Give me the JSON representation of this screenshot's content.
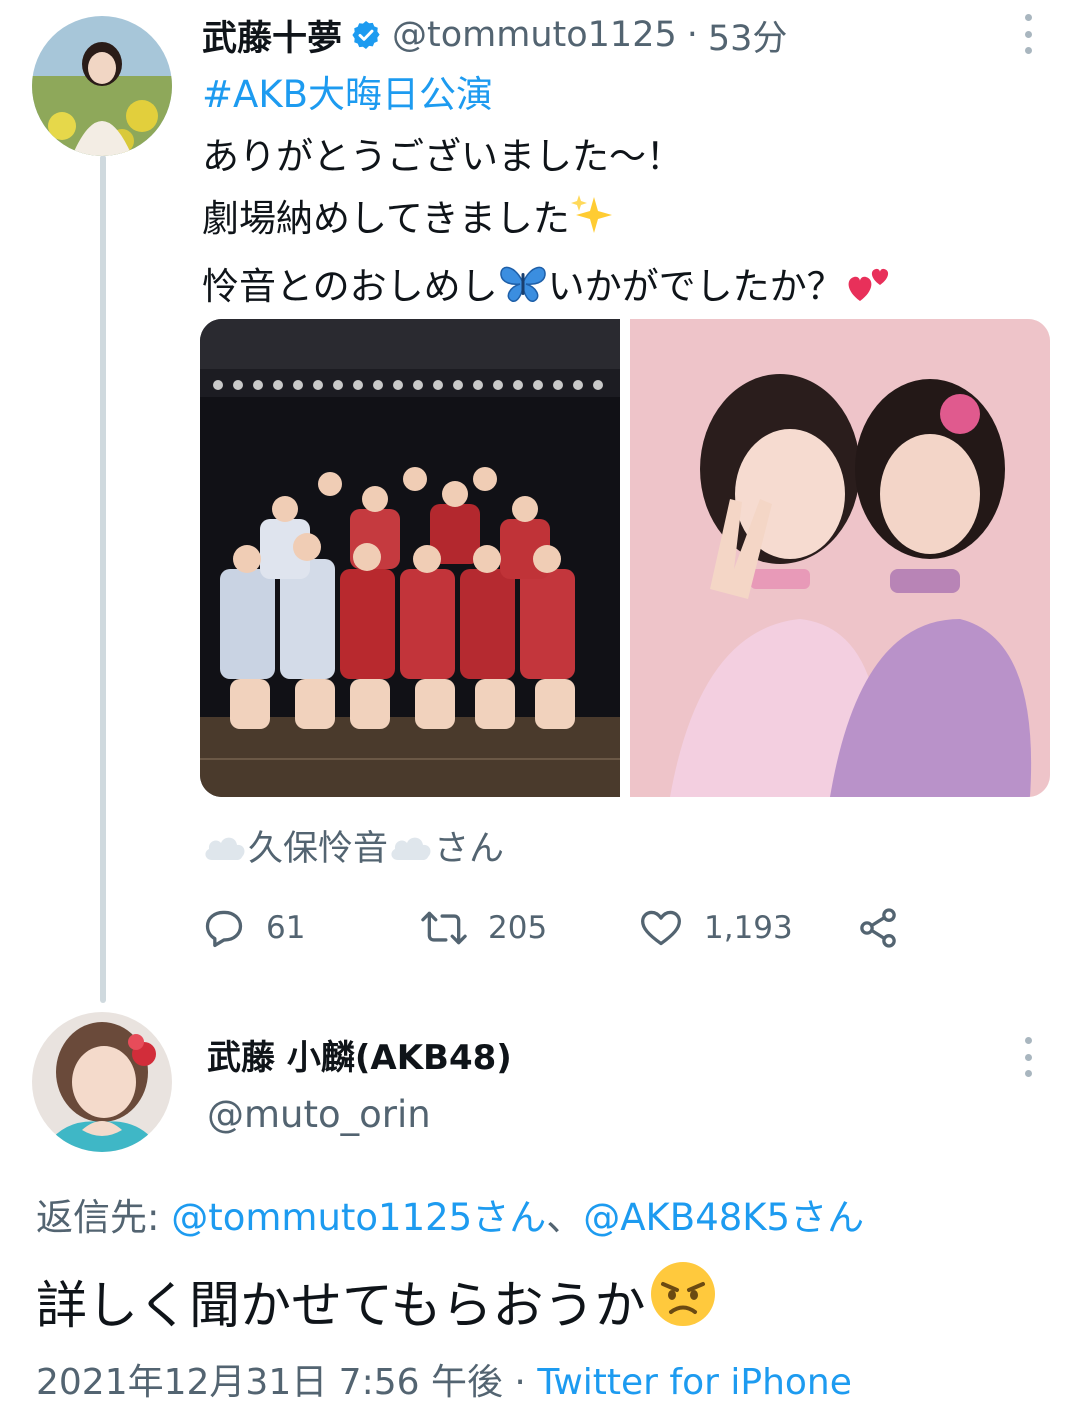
{
  "tweet1": {
    "display_name": "武藤十夢",
    "handle": "@tommuto1125",
    "separator": "·",
    "time_ago": "53分",
    "hashtag": "#AKB大晦日公演",
    "lines": [
      "ありがとうございました〜！",
      "劇場納めしてきました",
      "怜音とのおしめし",
      "いかがでしたか？"
    ],
    "tagged_name": "久保怜音",
    "tagged_suffix": "さん",
    "stats": {
      "replies": "61",
      "retweets": "205",
      "likes": "1,193"
    },
    "icons": [
      "verified-badge-icon",
      "sparkles-emoji",
      "butterfly-emoji",
      "two-hearts-emoji",
      "cloud-emoji",
      "reply-icon",
      "retweet-icon",
      "like-icon",
      "share-icon",
      "more-icon"
    ],
    "accent_color": "#1d9bf0"
  },
  "tweet2": {
    "display_name": "武藤 小麟(AKB48)",
    "handle": "@muto_orin",
    "reply_label": "返信先: ",
    "reply_mention_1": "@tommuto1125さん",
    "reply_sep": "、",
    "reply_mention_2": "@AKB48K5さん",
    "text": "詳しく聞かせてもらおうか",
    "icons": [
      "angry-face-emoji",
      "more-icon"
    ],
    "timestamp": "2021年12月31日 7:56 午後",
    "meta_separator": " · ",
    "source": "Twitter for iPhone"
  }
}
